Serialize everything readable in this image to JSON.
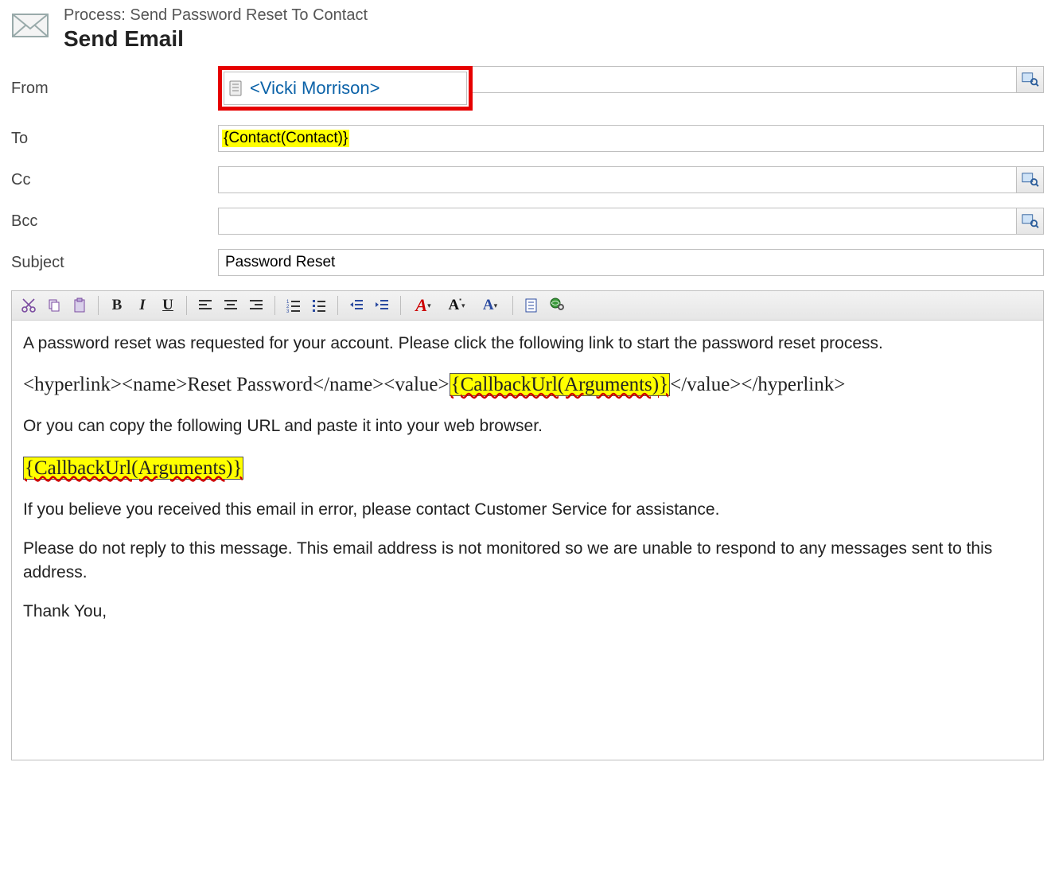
{
  "header": {
    "process_line": "Process: Send Password Reset To Contact",
    "title": "Send Email"
  },
  "fields": {
    "from_label": "From",
    "from_value": "<Vicki Morrison>",
    "to_label": "To",
    "to_value": "{Contact(Contact)}",
    "cc_label": "Cc",
    "cc_value": "",
    "bcc_label": "Bcc",
    "bcc_value": "",
    "subject_label": "Subject",
    "subject_value": "Password Reset"
  },
  "body": {
    "p1": "A password reset was requested for your account. Please click the following link to start the password reset process.",
    "hl_open1": "<hyperlink><name>",
    "hl_name": "Reset Password",
    "hl_mid": "</name><value>",
    "hl_tok1": "{CallbackUrl(Arguments)}",
    "hl_close": "</value></hyperlink>",
    "p3": "Or you can copy the following URL and paste it into your web browser.",
    "tok2": "{CallbackUrl(Arguments)}",
    "p5": "If you believe you received this email in error, please contact Customer Service for assistance.",
    "p6": "Please do not reply to this message. This email address is not monitored so we are unable to respond to any messages sent to this address.",
    "p7": "Thank You,"
  },
  "icons": {
    "mail": "mail-icon",
    "lookup": "lookup-icon",
    "record": "record-icon"
  }
}
